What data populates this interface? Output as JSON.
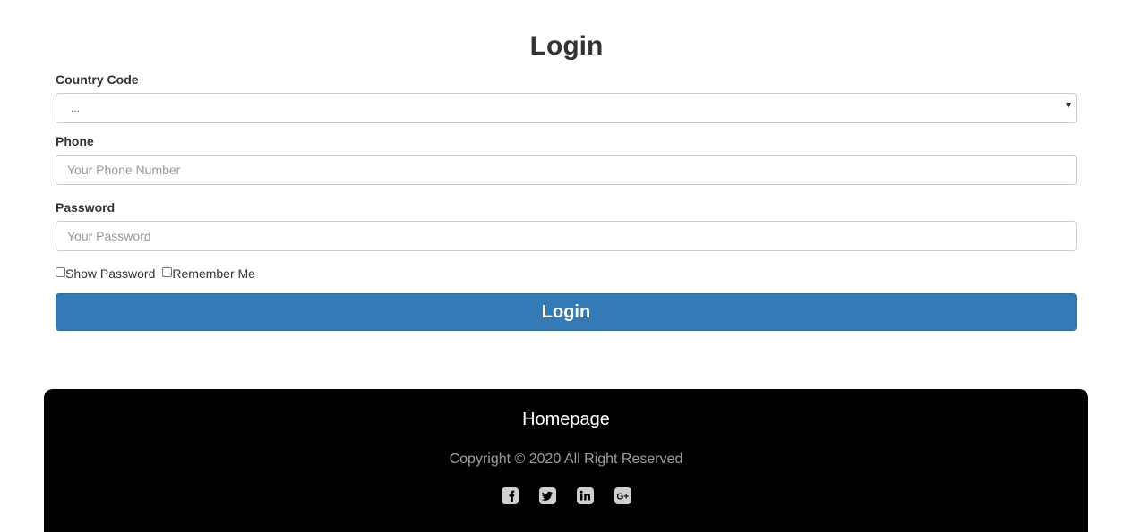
{
  "form": {
    "title": "Login",
    "country_label": "Country Code",
    "country_value": "...",
    "phone_label": "Phone",
    "phone_placeholder": "Your Phone Number",
    "password_label": "Password",
    "password_placeholder": "Your Password",
    "show_password_label": "Show Password",
    "remember_me_label": "Remember Me",
    "submit_label": "Login",
    "accent_color": "#337ab7"
  },
  "footer": {
    "homepage_link": "Homepage",
    "copyright": "Copyright © 2020 All Right Reserved",
    "social_icons": [
      "facebook-icon",
      "twitter-icon",
      "linkedin-icon",
      "google-plus-icon"
    ]
  }
}
